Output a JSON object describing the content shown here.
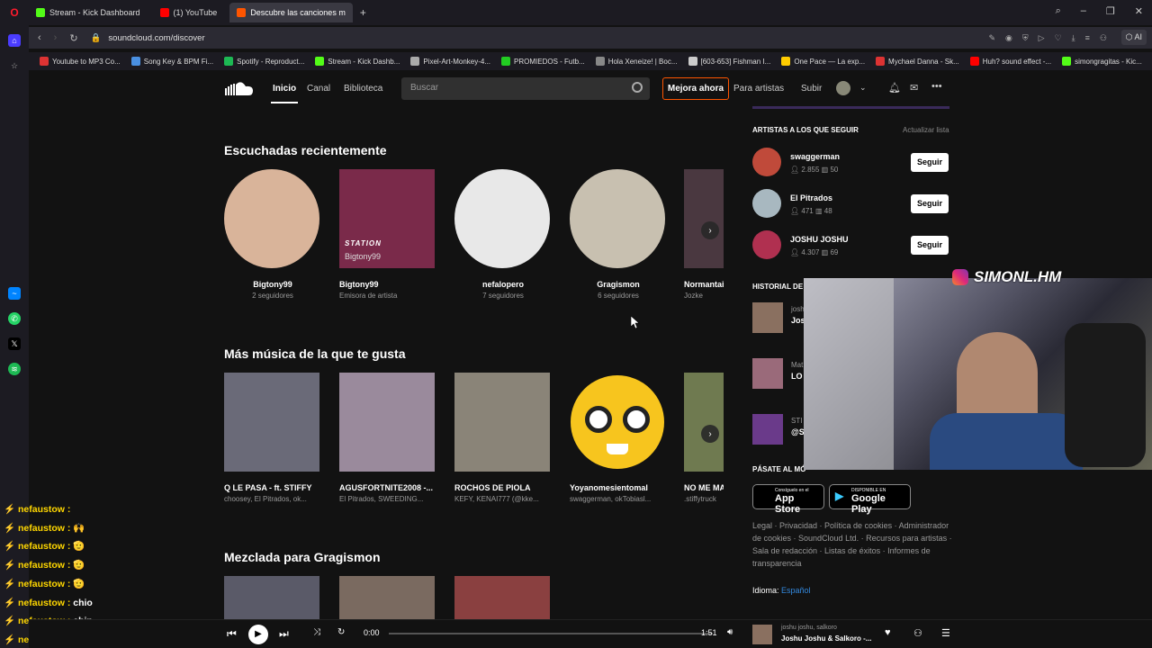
{
  "browser": {
    "tabs": [
      {
        "label": "Stream - Kick Dashboard",
        "color": "#53fc18"
      },
      {
        "label": "(1) YouTube",
        "color": "#ff0000"
      },
      {
        "label": "Descubre las canciones m",
        "color": "#ff5500"
      }
    ],
    "url": "soundcloud.com/discover",
    "bookmarks": [
      "Youtube to MP3 Co...",
      "Song Key & BPM Fi...",
      "Spotify - Reproduct...",
      "Stream - Kick Dashb...",
      "Pixel-Art-Monkey-4...",
      "PROMIEDOS - Futb...",
      "Hola Xeneize! | Boc...",
      "[603-653] Fishman I...",
      "One Pace — La exp...",
      "Mychael Danna - Sk...",
      "Huh? sound effect -...",
      "simongragitas - Kic..."
    ]
  },
  "header": {
    "nav": [
      "Inicio",
      "Canal",
      "Biblioteca"
    ],
    "search_placeholder": "Buscar",
    "premium": "Mejora ahora",
    "artists": "Para artistas",
    "upload": "Subir"
  },
  "recent": {
    "title": "Escuchadas recientemente",
    "items": [
      {
        "title": "Bigtony99",
        "sub": "2 seguidores",
        "round": true,
        "color": "#d9b49a"
      },
      {
        "title": "Bigtony99",
        "sub": "Emisora de artista",
        "round": false,
        "color": "#7a2a4a",
        "overlay1": "STATION",
        "overlay2": "Bigtony99"
      },
      {
        "title": "nefalopero",
        "sub": "7 seguidores",
        "round": true,
        "color": "#e8e8e8"
      },
      {
        "title": "Gragismon",
        "sub": "6 seguidores",
        "round": true,
        "color": "#c8c0b0"
      },
      {
        "title": "Normantai",
        "sub": "Jozke",
        "round": false,
        "color": "#4a3840"
      }
    ]
  },
  "more": {
    "title": "Más música de la que te gusta",
    "items": [
      {
        "title": "Q LE PASA - ft. STIFFY",
        "sub": "choosey, El Pitrados, ok...",
        "color": "#6a6a78"
      },
      {
        "title": "AGUSFORTNITE2008 -...",
        "sub": "El Pitrados, SWEEDING...",
        "color": "#9a8a9c"
      },
      {
        "title": "ROCHOS DE PIOLA",
        "sub": "KEFY, KENAI777 (@kke...",
        "color": "#8a8478"
      },
      {
        "title": "Yoyanomesientomal",
        "sub": "swaggerman, okTobiasl...",
        "color": "#f7c51e"
      },
      {
        "title": "NO ME MA",
        "sub": ".stiffytruck",
        "color": "#6f7a50"
      }
    ]
  },
  "mix": {
    "title": "Mezclada para Gragismon",
    "colors": [
      "#5a5a68",
      "#7a6a60",
      "#8a4040"
    ]
  },
  "right": {
    "follow_title": "ARTISTAS A LOS QUE SEGUIR",
    "refresh": "Actualizar lista",
    "artists": [
      {
        "name": "swaggerman",
        "followers": "2.855",
        "tracks": "50",
        "color": "#c04a3a"
      },
      {
        "name": "El Pitrados",
        "followers": "471",
        "tracks": "48",
        "color": "#a8b8c0"
      },
      {
        "name": "JOSHU JOSHU",
        "followers": "4.307",
        "tracks": "69",
        "color": "#b03050"
      }
    ],
    "follow_btn": "Seguir",
    "history_title": "HISTORIAL DE R",
    "history": [
      {
        "line1": "josh",
        "line2": "Josh",
        "color": "#8a7060"
      },
      {
        "line1": "Mat",
        "line2": "LO I",
        "color": "#9a6a7a"
      },
      {
        "line1": "STI",
        "line2": "@ST",
        "color": "#6a3a8a"
      }
    ],
    "mobile_title": "PÁSATE AL MÓ",
    "appstore_small": "Consíguelo en el",
    "appstore": "App Store",
    "gplay_small": "DISPONIBLE EN",
    "gplay": "Google Play",
    "footer": "Legal · Privacidad · Política de cookies · Administrador de cookies · SoundCloud Ltd. · Recursos para artistas · Sala de redacción · Listas de éxitos · Informes de transparencia",
    "lang_label": "Idioma:",
    "lang": "Español"
  },
  "webcam": {
    "handle": "SIMONL.HM"
  },
  "chat": [
    {
      "user": "nefaustow :",
      "msg": ""
    },
    {
      "user": "nefaustow :",
      "msg": "🙌"
    },
    {
      "user": "nefaustow :",
      "msg": "🫡"
    },
    {
      "user": "nefaustow :",
      "msg": "🫡"
    },
    {
      "user": "nefaustow :",
      "msg": "🫡"
    },
    {
      "user": "nefaustow :",
      "msg": "chio"
    },
    {
      "user": "nefaustow :",
      "msg": "chip"
    },
    {
      "user": "nefaustow :",
      "msg": "🟩"
    }
  ],
  "player": {
    "current": "0:00",
    "duration": "1:51",
    "artist": "joshu joshu, salkoro",
    "track": "Joshu Joshu & Salkoro -..."
  }
}
